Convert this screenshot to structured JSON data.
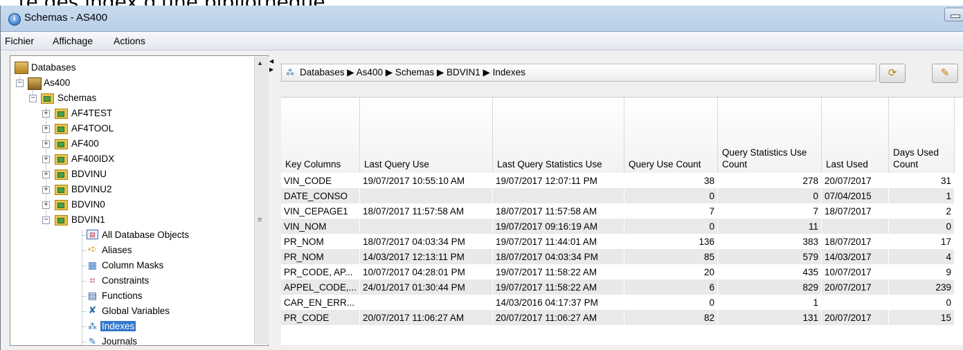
{
  "page_heading": "...te des index d'une bibliothèque",
  "window": {
    "title": "Schemas - AS400"
  },
  "menu": [
    "Fichier",
    "Affichage",
    "Actions"
  ],
  "tree": {
    "root": "Databases",
    "server": "As400",
    "schemas_label": "Schemas",
    "schemas": [
      "AF4TEST",
      "AF4TOOL",
      "AF400",
      "AF400IDX",
      "BDVINU",
      "BDVINU2",
      "BDVIN0",
      "BDVIN1"
    ],
    "bdvin1_children": [
      "All Database Objects",
      "Aliases",
      "Column Masks",
      "Constraints",
      "Functions",
      "Global Variables",
      "Indexes",
      "Journals"
    ],
    "selected": "Indexes"
  },
  "breadcrumb": "Databases ▶ As400 ▶ Schemas ▶ BDVIN1 ▶ Indexes",
  "toolbar": {
    "refresh_icon": "refresh-icon",
    "edit_icon": "edit-icon"
  },
  "table": {
    "headers": [
      "Key Columns",
      "Last Query Use",
      "Last Query Statistics Use",
      "Query Use Count",
      "Query Statistics Use Count",
      "Last Used",
      "Days Used Count"
    ],
    "rows": [
      [
        "VIN_CODE",
        "19/07/2017 10:55:10 AM",
        "19/07/2017 12:07:11 PM",
        "38",
        "278",
        "20/07/2017",
        "31"
      ],
      [
        "DATE_CONSO",
        "",
        "",
        "0",
        "0",
        "07/04/2015",
        "1"
      ],
      [
        "VIN_CEPAGE1",
        "18/07/2017 11:57:58 AM",
        "18/07/2017 11:57:58 AM",
        "7",
        "7",
        "18/07/2017",
        "2"
      ],
      [
        "VIN_NOM",
        "",
        "19/07/2017 09:16:19 AM",
        "0",
        "11",
        "",
        "0"
      ],
      [
        "PR_NOM",
        "18/07/2017 04:03:34 PM",
        "19/07/2017 11:44:01 AM",
        "136",
        "383",
        "18/07/2017",
        "17"
      ],
      [
        "PR_NOM",
        "14/03/2017 12:13:11 PM",
        "18/07/2017 04:03:34 PM",
        "85",
        "579",
        "14/03/2017",
        "4"
      ],
      [
        "PR_CODE, AP...",
        "10/07/2017 04:28:01 PM",
        "19/07/2017 11:58:22 AM",
        "20",
        "435",
        "10/07/2017",
        "9"
      ],
      [
        "APPEL_CODE,...",
        "24/01/2017 01:30:44 PM",
        "19/07/2017 11:58:22 AM",
        "6",
        "829",
        "20/07/2017",
        "239"
      ],
      [
        "CAR_EN_ERR...",
        "",
        "14/03/2016 04:17:37 PM",
        "0",
        "1",
        "",
        "0"
      ],
      [
        "PR_CODE",
        "20/07/2017 11:06:27 AM",
        "20/07/2017 11:06:27 AM",
        "82",
        "131",
        "20/07/2017",
        "15"
      ]
    ]
  }
}
